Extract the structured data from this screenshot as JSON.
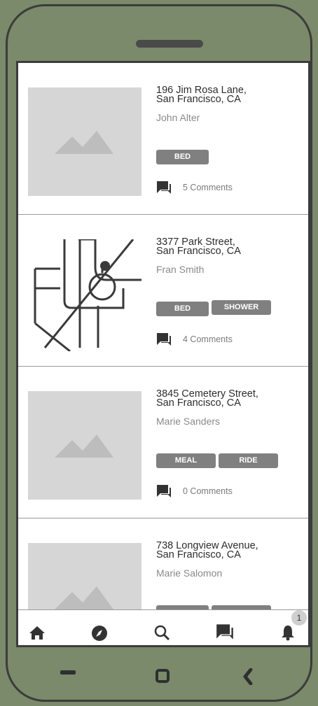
{
  "listings": [
    {
      "address": "196  Jim Rosa Lane,\nSan Francisco, CA",
      "name": "John Alter",
      "tags": [
        "BED"
      ],
      "comments": "5 Comments",
      "thumbnail": "image-placeholder"
    },
    {
      "address": "3377 Park Street,\nSan Francisco, CA",
      "name": "Fran Smith",
      "tags": [
        "BED",
        "SHOWER"
      ],
      "comments": "4 Comments",
      "thumbnail": "map-icon"
    },
    {
      "address": "3845  Cemetery Street,\nSan Francisco, CA",
      "name": "Marie Sanders",
      "tags": [
        "MEAL",
        "RIDE"
      ],
      "comments": "0 Comments",
      "thumbnail": "image-placeholder"
    },
    {
      "address": "738  Longview Avenue,\nSan Francisco, CA",
      "name": "Marie Salomon",
      "tags": [
        "",
        ""
      ],
      "comments": "",
      "thumbnail": "image-placeholder"
    }
  ],
  "tabbar": {
    "items": [
      "home-icon",
      "compass-icon",
      "search-icon",
      "chat-icon",
      "bell-icon"
    ],
    "notification_count": "1"
  },
  "colors": {
    "device": "#7a8a6a",
    "frame": "#3c3c3c",
    "tag": "#808080",
    "placeholder": "#d6d6d6"
  }
}
